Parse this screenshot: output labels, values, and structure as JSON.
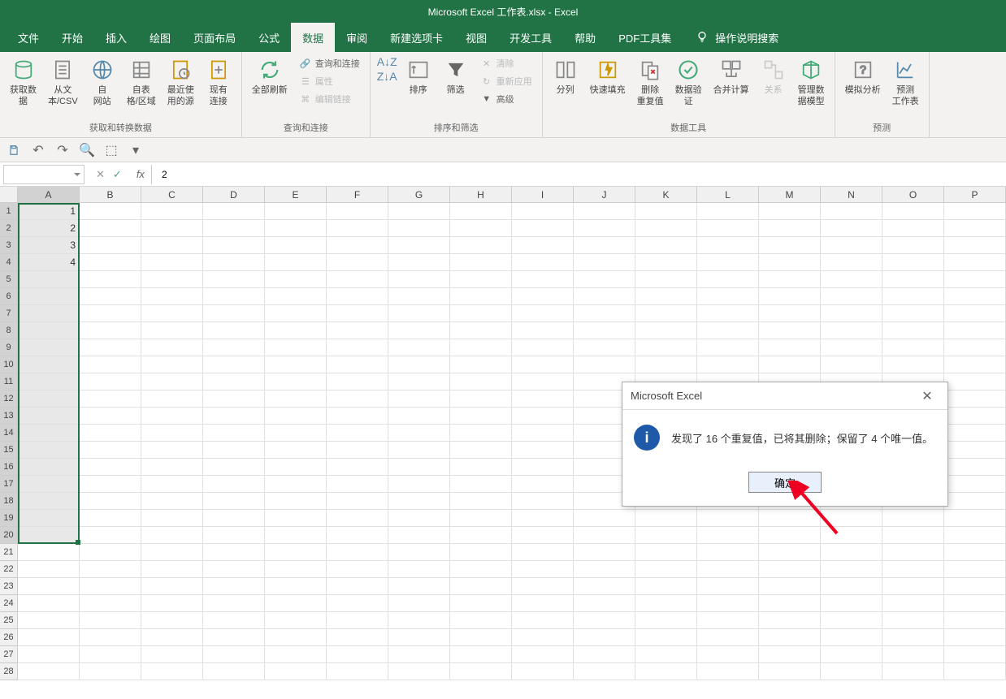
{
  "app": {
    "title": "Microsoft Excel 工作表.xlsx  -  Excel"
  },
  "tabs": {
    "file": "文件",
    "home": "开始",
    "insert": "插入",
    "draw": "绘图",
    "layout": "页面布局",
    "formulas": "公式",
    "data": "数据",
    "review": "审阅",
    "newtab": "新建选项卡",
    "view": "视图",
    "dev": "开发工具",
    "help": "帮助",
    "pdf": "PDF工具集",
    "tell": "操作说明搜索"
  },
  "ribbon": {
    "group1_label": "获取和转换数据",
    "get_data": "获取数\n据",
    "from_csv": "从文\n本/CSV",
    "from_web": "自\n网站",
    "from_table": "自表\n格/区域",
    "recent": "最近使\n用的源",
    "existing": "现有\n连接",
    "group2_label": "查询和连接",
    "refresh_all": "全部刷新",
    "queries": "查询和连接",
    "properties": "属性",
    "edit_links": "编辑链接",
    "group3_label": "排序和筛选",
    "sort": "排序",
    "filter": "筛选",
    "clear": "清除",
    "reapply": "重新应用",
    "advanced": "高级",
    "group4_label": "数据工具",
    "text_cols": "分列",
    "flash_fill": "快速填充",
    "remove_dup": "删除\n重复值",
    "validation": "数据验\n证",
    "consolidate": "合并计算",
    "relations": "关系",
    "data_model": "管理数\n据模型",
    "group5_label": "预测",
    "whatif": "模拟分析",
    "forecast": "预测\n工作表"
  },
  "formula_bar": {
    "name_box": "",
    "value": "2"
  },
  "columns": [
    "A",
    "B",
    "C",
    "D",
    "E",
    "F",
    "G",
    "H",
    "I",
    "J",
    "K",
    "L",
    "M",
    "N",
    "O",
    "P"
  ],
  "rows_count": 28,
  "cell_data": {
    "A1": "1",
    "A2": "2",
    "A3": "3",
    "A4": "4"
  },
  "selection": {
    "col": "A",
    "rows_from": 1,
    "rows_to": 20
  },
  "dialog": {
    "title": "Microsoft Excel",
    "message": "发现了 16 个重复值，已将其删除；保留了 4 个唯一值。",
    "ok": "确定"
  },
  "chart_data": null
}
